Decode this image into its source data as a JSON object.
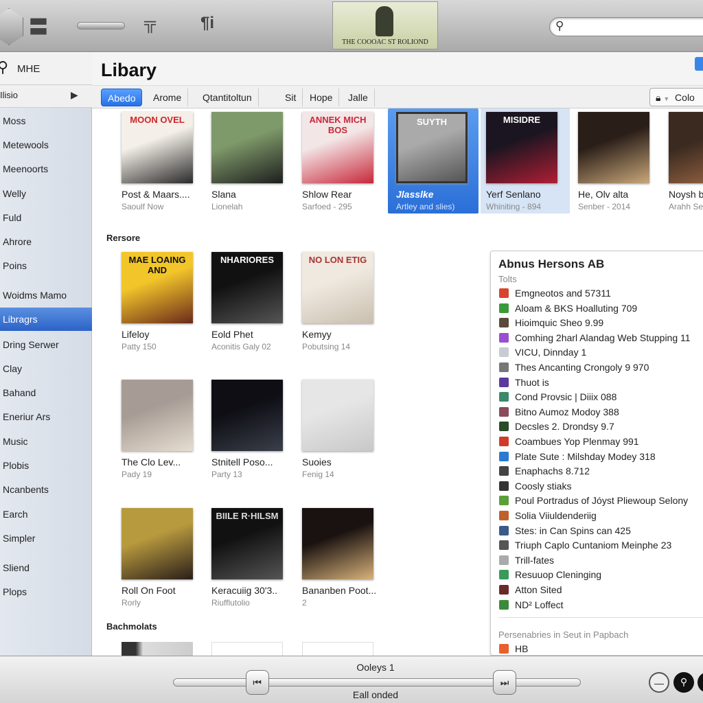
{
  "toolbar": {
    "now_playing_art_text": "THE COOOAC ST ROLIOND",
    "icons": [
      "app-logo",
      "menu-icon",
      "volume-slider",
      "equalizer-icon",
      "info-icon"
    ],
    "search_placeholder": ""
  },
  "sidebar": {
    "search_label": "MHE",
    "section_label": "Ilisio",
    "items": [
      {
        "label": "Moss"
      },
      {
        "label": "Metewools"
      },
      {
        "label": "Meenoorts"
      },
      {
        "label": "Welly"
      },
      {
        "label": "Fuld"
      },
      {
        "label": "Ahrore"
      },
      {
        "label": "Poins"
      },
      {
        "label": "Woidms Mamo"
      },
      {
        "label": "Libragrs",
        "selected": true
      },
      {
        "label": "Dring Serwer"
      },
      {
        "label": "Clay"
      },
      {
        "label": "Bahand"
      },
      {
        "label": "Eneriur Ars"
      },
      {
        "label": "Music"
      },
      {
        "label": "Plobis"
      },
      {
        "label": "Ncanbents"
      },
      {
        "label": "Earch"
      },
      {
        "label": "Simpler"
      },
      {
        "label": "Sliend"
      },
      {
        "label": "Plops"
      }
    ]
  },
  "header": {
    "title": "Libary",
    "right_button": "Colo"
  },
  "tabs": [
    {
      "label": "Abedo",
      "selected": true
    },
    {
      "label": "Arome"
    },
    {
      "label": "Qtantitoltun"
    },
    {
      "label": "Sit"
    },
    {
      "label": "Hope"
    },
    {
      "label": "Jalle"
    }
  ],
  "top_row": [
    {
      "title": "Post & Maars....",
      "sub": "Saoulf Now",
      "art_text": "MOON OVEL",
      "c1": "#f4efe8",
      "c2": "#2a2a2a",
      "tc": "#d0252b"
    },
    {
      "title": "Slana",
      "sub": "Lionelah",
      "art_text": "",
      "c1": "#7f9a6a",
      "c2": "#1e1e1e",
      "tc": "#fff"
    },
    {
      "title": "Shlow Rear",
      "sub": "Sarfoed - 295",
      "art_text": "ANNEK MICH BOS",
      "c1": "#f3e6e6",
      "c2": "#c8283a",
      "tc": "#c8283a"
    },
    {
      "title": "Jlasslke",
      "sub": "Artley and slies)",
      "art_text": "SUYTH",
      "c1": "#aaa",
      "c2": "#555",
      "tc": "#fff",
      "selected": true
    },
    {
      "title": "Yerf Senlano",
      "sub": "Whiniting - 894",
      "art_text": "MISIDRE",
      "c1": "#1a1520",
      "c2": "#b01e35",
      "tc": "#fff",
      "highlight": true
    },
    {
      "title": "He, Olv alta",
      "sub": "Senber - 2014",
      "art_text": "",
      "c1": "#2a1e18",
      "c2": "#c9a77a",
      "tc": "#fff"
    },
    {
      "title": "Noysh b",
      "sub": "Arahh Se",
      "art_text": "",
      "c1": "#3a2a20",
      "c2": "#a06a45",
      "tc": "#fff"
    }
  ],
  "sections": [
    {
      "title": "Rersore"
    },
    {
      "title": "Bachmolats"
    }
  ],
  "grid": [
    {
      "title": "Lifeloy",
      "sub": "Patty 150",
      "art_text": "MAE LOAING AND",
      "c1": "#f2c62a",
      "c2": "#6a2a1a",
      "tc": "#111"
    },
    {
      "title": "Eold Phet",
      "sub": "Aconitis Galy 02",
      "art_text": "NHARIORES",
      "c1": "#111",
      "c2": "#555",
      "tc": "#fff"
    },
    {
      "title": "Kemyy",
      "sub": "Pobutsing 14",
      "art_text": "NO LON ETIG",
      "c1": "#efe9e0",
      "c2": "#c9bfae",
      "tc": "#a33"
    },
    {
      "title": "The Clo Lev...",
      "sub": "Pady 19",
      "art_text": "",
      "c1": "#a79c95",
      "c2": "#e6ddd0",
      "tc": "#fff"
    },
    {
      "title": "Stnitell Poso...",
      "sub": "Party 13",
      "art_text": "",
      "c1": "#0e0e14",
      "c2": "#3a3f4a",
      "tc": "#d9b24a"
    },
    {
      "title": "Suoies",
      "sub": "Fenig 14",
      "art_text": "",
      "c1": "#e6e6e6",
      "c2": "#c8c8c8",
      "tc": "#d06a1a"
    },
    {
      "title": "Roll On Foot",
      "sub": "Rorly",
      "art_text": "",
      "c1": "#b89a3e",
      "c2": "#2a1e1a",
      "tc": "#fff"
    },
    {
      "title": "Keracuiig 30'3..",
      "sub": "Riufflutolio",
      "art_text": "BIILE R·HILSM",
      "c1": "#111",
      "c2": "#555",
      "tc": "#ddd"
    },
    {
      "title": "Bananben Poot...",
      "sub": "2",
      "art_text": "",
      "c1": "#1a1210",
      "c2": "#d8b27a",
      "tc": "#fff"
    }
  ],
  "panel": {
    "title": "Abnus Hersons  AB",
    "subtitle": "Tolts",
    "items": [
      {
        "label": "Emgneotos and 57311",
        "color": "#d9432c"
      },
      {
        "label": "Aloam & BKS Hoalluting 709",
        "color": "#3a9a3a"
      },
      {
        "label": "Hioimquic Sheo 9.99",
        "color": "#5a4a3a"
      },
      {
        "label": "Comhing 2harl Alandag Web Stupping 11",
        "color": "#9b4fd0"
      },
      {
        "label": "VICU, Dinnday 1",
        "color": "#c8ccd2"
      },
      {
        "label": "Thes Ancanting Crongoly 9 970",
        "color": "#777"
      },
      {
        "label": "Thuot is",
        "color": "#5a3aa0"
      },
      {
        "label": "Cond Provsic | Diiix 088",
        "color": "#3a8a6a"
      },
      {
        "label": "Bitno Aumoz Modoy 388",
        "color": "#8a4a5a"
      },
      {
        "label": "Decsles 2. Drondsy 9.7",
        "color": "#2a4a2a"
      },
      {
        "label": "Coambues Yop Plenmay 991",
        "color": "#d03a2a"
      },
      {
        "label": "Plate Sute : Milshday Modey 318",
        "color": "#2a7ad0"
      },
      {
        "label": "Enaphachs 8.712",
        "color": "#444"
      },
      {
        "label": "Coosly stiaks",
        "color": "#333"
      },
      {
        "label": "Poul Portradus of Jóyst Pliewoup Selony",
        "color": "#5aa03a"
      },
      {
        "label": "Solia Viiuldenderiig",
        "color": "#c0602a"
      },
      {
        "label": "Stes: in Can Spins can 425",
        "color": "#3a5a8a"
      },
      {
        "label": "Triuph Caplo Cuntaniom Meinphe 23",
        "color": "#555"
      },
      {
        "label": "Trill-fates",
        "color": "#aaa"
      },
      {
        "label": "Resuuop Cleninging",
        "color": "#3a9a5a"
      },
      {
        "label": "Atton Sited",
        "color": "#6a2a2a"
      },
      {
        "label": "ND² Loffect",
        "color": "#3a8a3a"
      }
    ],
    "footer_label": "Persenabries in Seut in Papbach",
    "footer_item": {
      "label": "HB",
      "color": "#e8602a"
    }
  },
  "player": {
    "track_title": "Ooleys 1",
    "track_sub": "Eall onded",
    "progress": 0.06
  }
}
